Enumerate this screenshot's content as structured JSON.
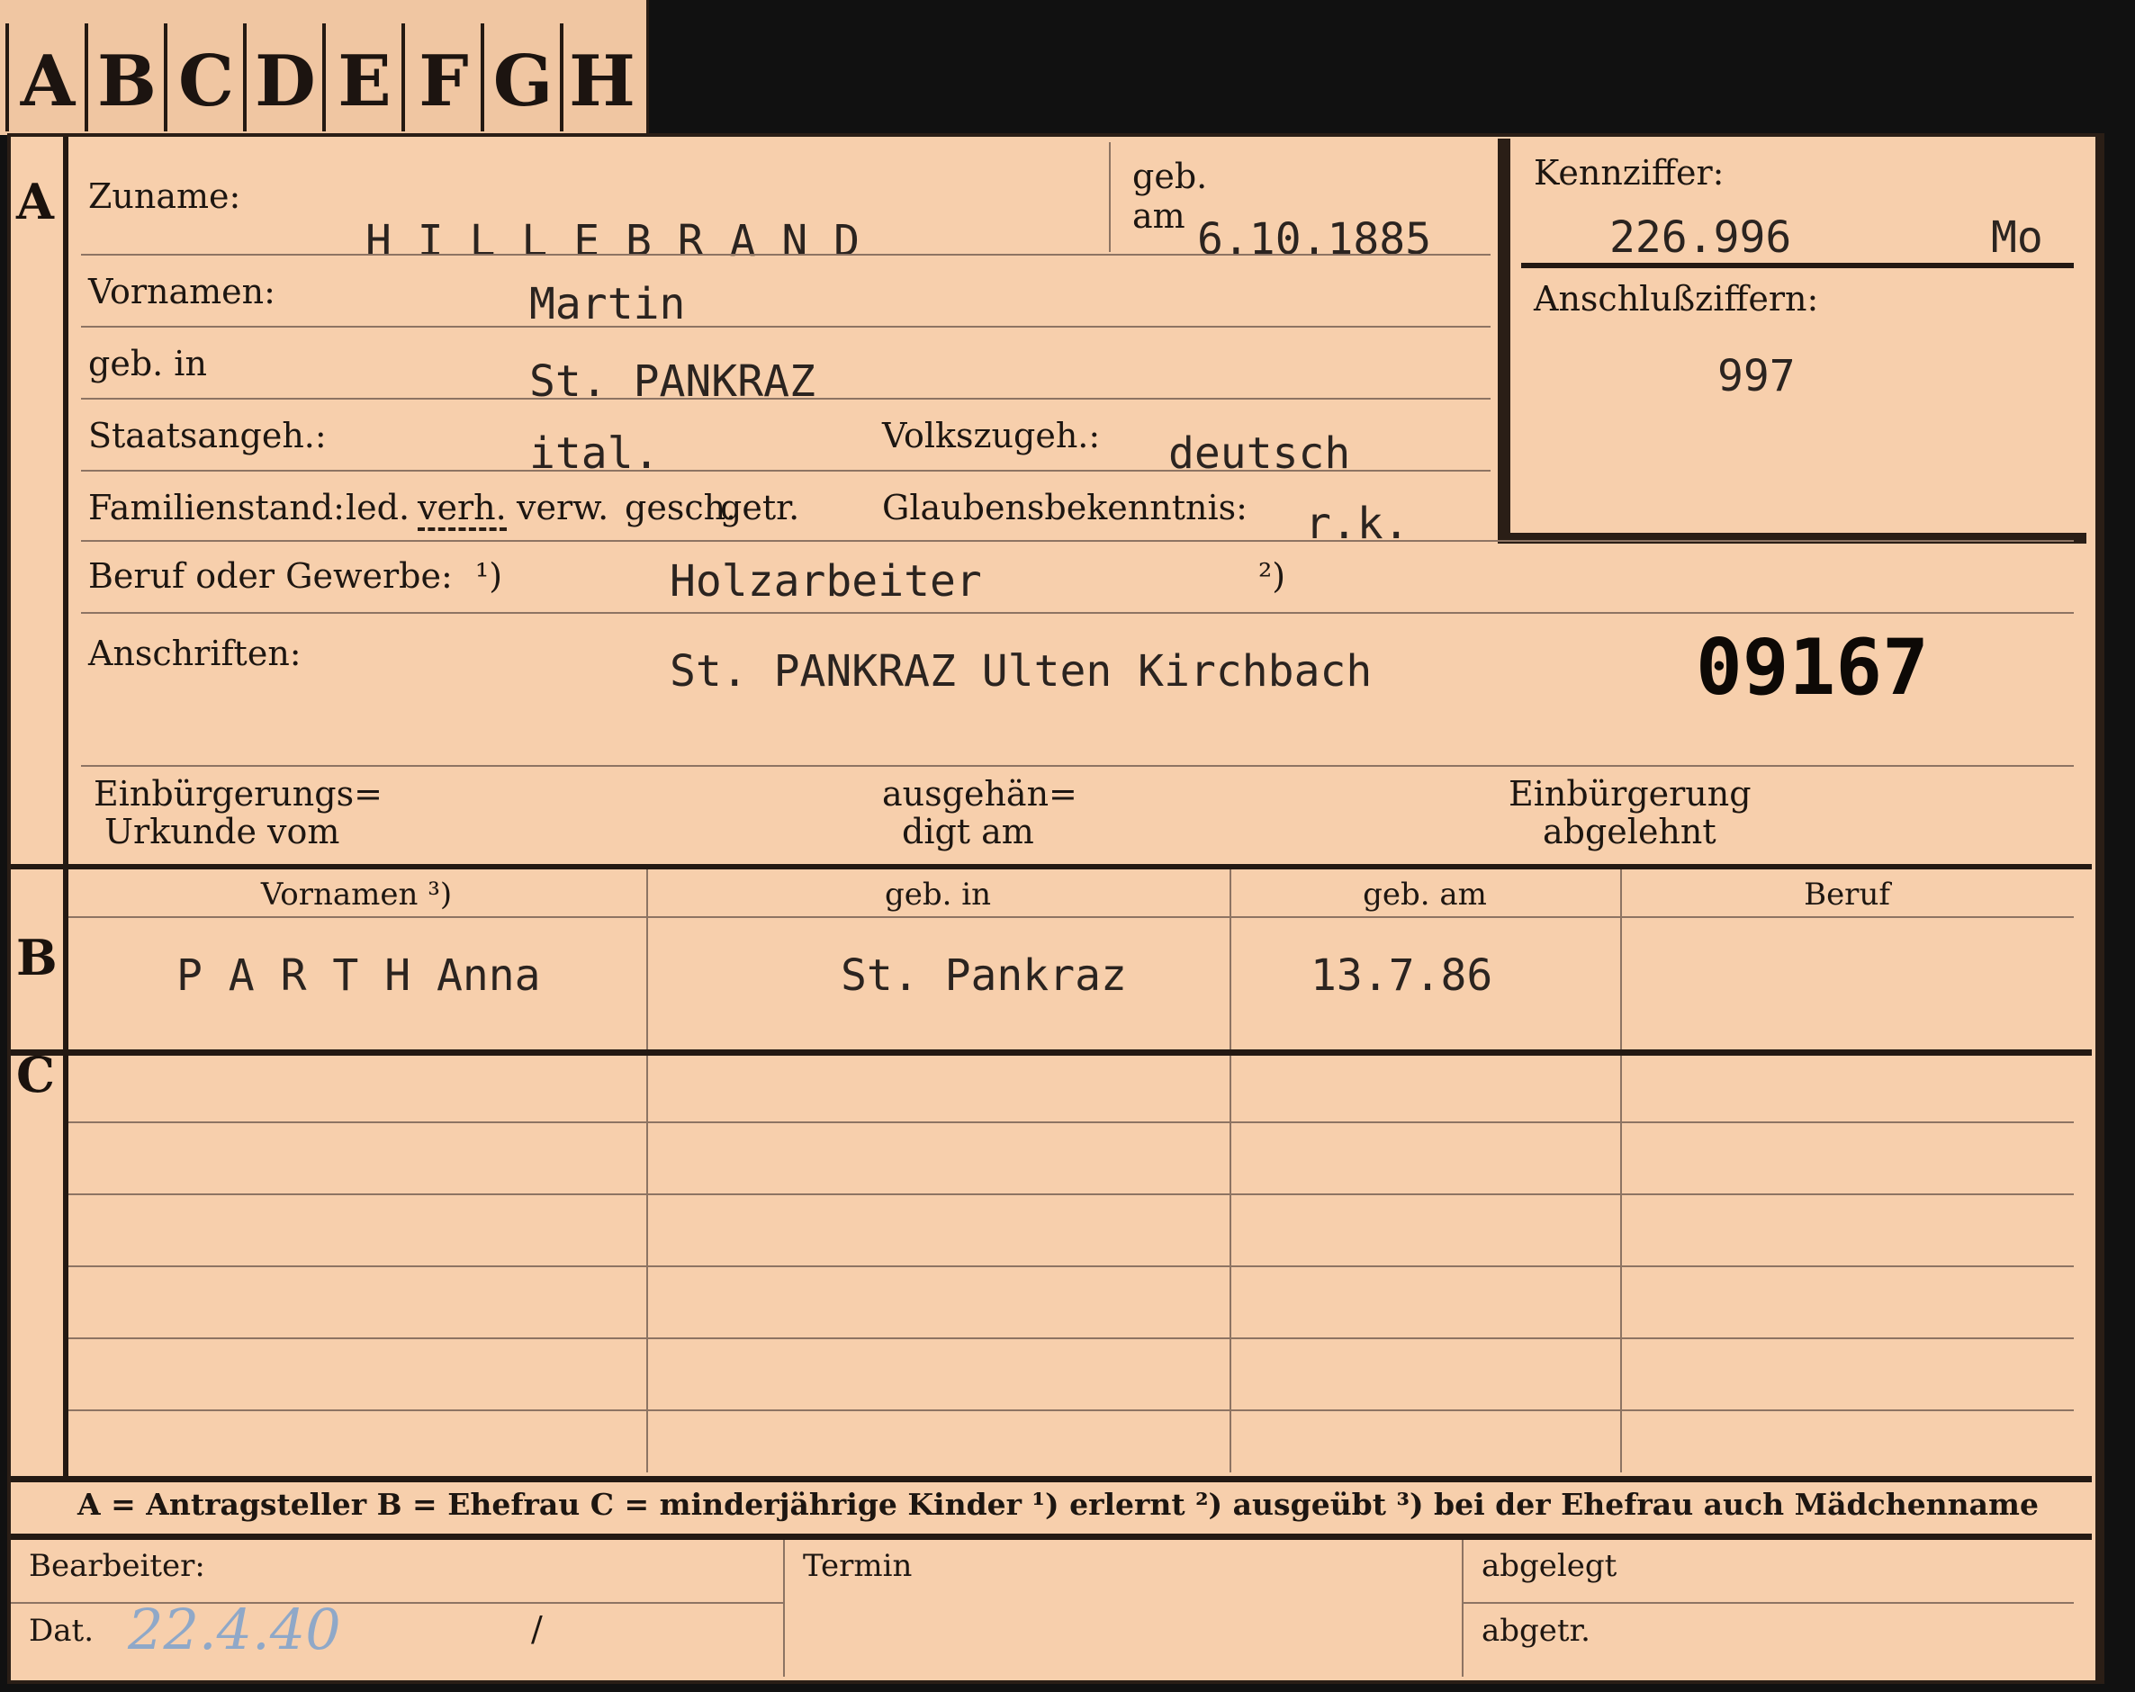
{
  "tabs": [
    "A",
    "B",
    "C",
    "D",
    "E",
    "F",
    "G",
    "H"
  ],
  "section_markers": {
    "a": "A",
    "b": "B",
    "c": "C"
  },
  "labels": {
    "zuname": "Zuname:",
    "geb": "geb.",
    "am": "am",
    "kennziffer": "Kennziffer:",
    "anschlussziffern": "Anschlußziffern:",
    "vornamen": "Vornamen:",
    "geb_in": "geb. in",
    "staatsangeh": "Staatsangeh.:",
    "volkszugeh": "Volkszugeh.:",
    "familienstand": "Familienstand:",
    "fam_led": "led.",
    "fam_verh": "verh.",
    "fam_verw": "verw.",
    "fam_gesch": "gesch.",
    "fam_getr": "getr.",
    "glaubensbekenntnis": "Glaubensbekenntnis:",
    "beruf": "Beruf oder Gewerbe:",
    "fn1": "¹)",
    "fn2": "²)",
    "anschriften": "Anschriften:",
    "einb_urkunde_1": "Einbürgerungs=",
    "einb_urkunde_2": "Urkunde vom",
    "ausgehaendigt_1": "ausgehän=",
    "ausgehaendigt_2": "digt am",
    "einb_abgelehnt_1": "Einbürgerung",
    "einb_abgelehnt_2": "abgelehnt"
  },
  "applicant": {
    "zuname": "H I L L E B R A N D",
    "geb_am": "6.10.1885",
    "kennziffer": "226.996",
    "kennziffer_suffix": "Mo",
    "anschlussziffer": "997",
    "vornamen": "Martin",
    "geb_in": "St. PANKRAZ",
    "staatsangeh": "ital.",
    "volkszugeh": "deutsch",
    "glaubensbekenntnis": "r.k.",
    "beruf": "Holzarbeiter",
    "anschrift": "St. PANKRAZ Ulten Kirchbach",
    "stamp_number": "09167"
  },
  "table": {
    "headers": [
      "Vornamen ³)",
      "geb. in",
      "geb. am",
      "Beruf"
    ],
    "spouse_row": [
      "P A R T H  Anna",
      "St. Pankraz",
      "13.7.86",
      ""
    ]
  },
  "legend": "A = Antragsteller   B = Ehefrau   C = minderjährige Kinder   ¹) erlernt   ²) ausgeübt   ³) bei der Ehefrau auch Mädchenname",
  "footer": {
    "bearbeiter": "Bearbeiter:",
    "termin": "Termin",
    "abgelegt": "abgelegt",
    "dat": "Dat.",
    "dat_value": "22.4.40",
    "slash": "/",
    "abgetr": "abgetr."
  }
}
